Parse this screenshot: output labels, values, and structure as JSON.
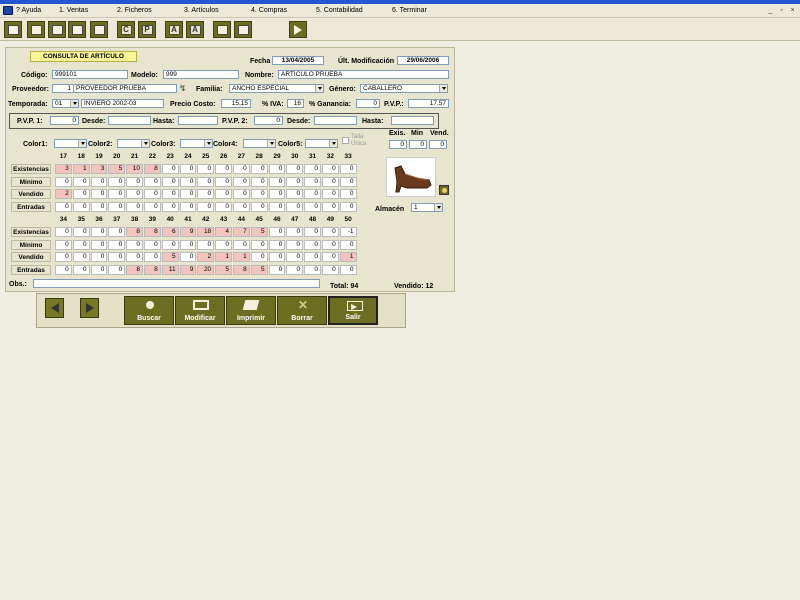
{
  "menu": {
    "items": [
      "? Ayuda",
      "1. Ventas",
      "2. Ficheros",
      "3. Artículos",
      "4. Compras",
      "5. Contabilidad",
      "6. Terminar"
    ],
    "win_controls": [
      "_",
      "▫",
      "×"
    ]
  },
  "toolbar": {
    "buttons": [
      "doc-icon",
      "doc-icon",
      "doc-icon",
      "doc-icon",
      "C",
      "P",
      "A",
      "A",
      "doc-icon",
      "doc-icon",
      "arrow-icon"
    ],
    "c_label": "C",
    "p_label": "P",
    "a_label": "A"
  },
  "form": {
    "title": "CONSULTA DE ARTÍCULO",
    "fecha_alta_label": "Fecha de Alta",
    "fecha_alta": "13/04/2005",
    "ult_mod_label": "Últ. Modificación",
    "ult_mod": "29/06/2006",
    "codigo_label": "Código:",
    "codigo": "999101",
    "modelo_label": "Modelo:",
    "modelo": "999",
    "nombre_label": "Nombre:",
    "nombre": "ARTICULO PRUEBA",
    "proveedor_label": "Proveedor:",
    "proveedor_num": "1",
    "proveedor": "PROVEEDOR PRUEBA",
    "familia_label": "Familia:",
    "familia": "ANCHO ESPECIAL",
    "genero_label": "Género:",
    "genero": "CABALLERO",
    "temporada_label": "Temporada:",
    "temporada_num": "01",
    "temporada": "INVIERO 2002-03",
    "precio_costo_label": "Precio Costo:",
    "precio_costo": "15,15",
    "iva_label": "% IVA:",
    "iva": "16",
    "ganancia_label": "% Ganancia:",
    "ganancia": "0",
    "pvp_label": "P.V.P.:",
    "pvp": "17,57",
    "pvp1_label": "P.V.P. 1:",
    "pvp1": "0",
    "desde1_label": "Desde:",
    "hasta1_label": "Hasta:",
    "pvp2_label": "P.V.P. 2:",
    "pvp2": "0",
    "desde2_label": "Desde:",
    "hasta2_label": "Hasta:",
    "color_labels": [
      "Color1:",
      "Color2:",
      "Color3:",
      "Color4:",
      "Color5:"
    ],
    "talla_unica": "Talla Única",
    "exis_label": "Exis.",
    "min_label": "Min",
    "vend_label": "Vend.",
    "exis": "0",
    "min": "0",
    "vend": "0",
    "almacen_label": "Almacén",
    "almacen": "1",
    "obs_label": "Obs.:",
    "total_label": "Total: 94",
    "vendido_label": "Vendido: 12"
  },
  "grid1": {
    "sizes": [
      "17",
      "18",
      "19",
      "20",
      "21",
      "22",
      "23",
      "24",
      "25",
      "26",
      "27",
      "28",
      "29",
      "30",
      "31",
      "32",
      "33"
    ],
    "rows": [
      {
        "label": "Existencias",
        "values": [
          "3",
          "1",
          "3",
          "5",
          "10",
          "8",
          "0",
          "0",
          "0",
          "0",
          "0",
          "0",
          "0",
          "0",
          "0",
          "0",
          "0"
        ],
        "hl": [
          0,
          1,
          2,
          3,
          4,
          5
        ]
      },
      {
        "label": "Mínimo",
        "values": [
          "0",
          "0",
          "0",
          "0",
          "0",
          "0",
          "0",
          "0",
          "0",
          "0",
          "0",
          "0",
          "0",
          "0",
          "0",
          "0",
          "0"
        ],
        "hl": []
      },
      {
        "label": "Vendido",
        "values": [
          "2",
          "0",
          "0",
          "0",
          "0",
          "0",
          "0",
          "0",
          "0",
          "0",
          "0",
          "0",
          "0",
          "0",
          "0",
          "0",
          "0"
        ],
        "hl": [
          0
        ]
      },
      {
        "label": "Entradas",
        "values": [
          "0",
          "0",
          "0",
          "0",
          "0",
          "0",
          "0",
          "0",
          "0",
          "0",
          "0",
          "0",
          "0",
          "0",
          "0",
          "0",
          "0"
        ],
        "hl": []
      }
    ]
  },
  "grid2": {
    "sizes": [
      "34",
      "35",
      "36",
      "37",
      "38",
      "39",
      "40",
      "41",
      "42",
      "43",
      "44",
      "45",
      "46",
      "47",
      "48",
      "49",
      "50"
    ],
    "rows": [
      {
        "label": "Existencias",
        "values": [
          "0",
          "0",
          "0",
          "0",
          "8",
          "8",
          "6",
          "9",
          "18",
          "4",
          "7",
          "5",
          "0",
          "0",
          "0",
          "0",
          "-1"
        ],
        "hl": [
          4,
          5,
          6,
          7,
          8,
          9,
          10,
          11
        ]
      },
      {
        "label": "Mínimo",
        "values": [
          "0",
          "0",
          "0",
          "0",
          "0",
          "0",
          "0",
          "0",
          "0",
          "0",
          "0",
          "0",
          "0",
          "0",
          "0",
          "0",
          "0"
        ],
        "hl": []
      },
      {
        "label": "Vendido",
        "values": [
          "0",
          "0",
          "0",
          "0",
          "0",
          "0",
          "5",
          "0",
          "2",
          "1",
          "1",
          "0",
          "0",
          "0",
          "0",
          "0",
          "1"
        ],
        "hl": [
          6,
          8,
          9,
          10,
          16
        ]
      },
      {
        "label": "Entradas",
        "values": [
          "0",
          "0",
          "0",
          "0",
          "8",
          "8",
          "11",
          "9",
          "20",
          "5",
          "8",
          "5",
          "0",
          "0",
          "0",
          "0",
          "0"
        ],
        "hl": [
          4,
          5,
          6,
          7,
          8,
          9,
          10,
          11
        ]
      }
    ]
  },
  "actions": {
    "buscar": "Buscar",
    "modificar": "Modificar",
    "imprimir": "Imprimir",
    "borrar": "Borrar",
    "salir": "Salir"
  },
  "colors": {
    "accent": "#6b6d20",
    "highlight": "#f2c4bd",
    "title_tag": "#f8f49a"
  }
}
